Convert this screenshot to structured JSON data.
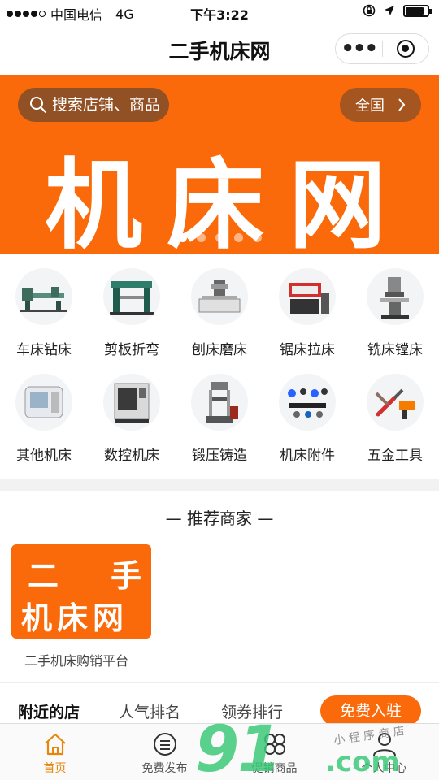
{
  "status_bar": {
    "carrier": "中国电信",
    "network": "4G",
    "time": "下午3:22"
  },
  "nav": {
    "title": "二手机床网"
  },
  "banner": {
    "search_placeholder": "搜索店铺、商品",
    "region_label": "全国",
    "banner_text": "机床网",
    "slide_count": 5,
    "active_slide": 1
  },
  "categories": [
    {
      "label": "车床钻床",
      "icon": "lathe-icon"
    },
    {
      "label": "剪板折弯",
      "icon": "shearing-machine-icon"
    },
    {
      "label": "刨床磨床",
      "icon": "grinder-icon"
    },
    {
      "label": "锯床拉床",
      "icon": "sawing-machine-icon"
    },
    {
      "label": "铣床镗床",
      "icon": "milling-machine-icon"
    },
    {
      "label": "其他机床",
      "icon": "machine-icon"
    },
    {
      "label": "数控机床",
      "icon": "cnc-machine-icon"
    },
    {
      "label": "锻压铸造",
      "icon": "press-icon"
    },
    {
      "label": "机床附件",
      "icon": "accessories-icon"
    },
    {
      "label": "五金工具",
      "icon": "tools-icon"
    }
  ],
  "recommended": {
    "title": "— 推荐商家 —",
    "merchant": {
      "logo_line1_a": "二",
      "logo_line1_b": "手",
      "logo_line2": "机床网",
      "name": "二手机床购销平台"
    }
  },
  "tabs": {
    "items": [
      "附近的店",
      "人气排名",
      "领券排行"
    ],
    "active": 0,
    "join_label": "免费入驻"
  },
  "tabbar": {
    "items": [
      {
        "label": "首页",
        "icon": "home-icon"
      },
      {
        "label": "免费发布",
        "icon": "publish-icon"
      },
      {
        "label": "促销商品",
        "icon": "promotion-icon"
      },
      {
        "label": "个人中心",
        "icon": "user-icon"
      }
    ],
    "active": 0
  },
  "watermark": {
    "main": "91",
    "sub": "小 程 序 商 店",
    "domain": ".com"
  },
  "colors": {
    "brand_orange": "#fa6a0a",
    "active_tab": "#e8860c"
  }
}
